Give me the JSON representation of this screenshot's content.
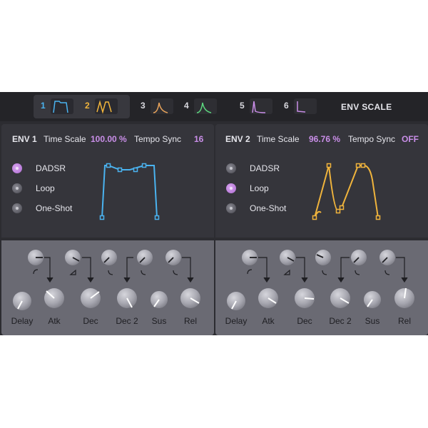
{
  "tabs": [
    {
      "num": "1",
      "color": "#4ab3f0",
      "active": true,
      "shape": "dadsr"
    },
    {
      "num": "2",
      "color": "#f0b43c",
      "active": true,
      "shape": "loop"
    },
    {
      "num": "3",
      "color": "#e8a35a",
      "active": false,
      "shape": "spike"
    },
    {
      "num": "4",
      "color": "#5cd67e",
      "active": false,
      "shape": "spike"
    },
    {
      "num": "5",
      "color": "#c98ee8",
      "active": false,
      "shape": "pulse"
    },
    {
      "num": "6",
      "color": "#c98ee8",
      "active": false,
      "shape": "drop"
    }
  ],
  "env_scale_label": "ENV SCALE",
  "envs": [
    {
      "title": "ENV 1",
      "time_scale_label": "Time Scale",
      "time_scale_value": "100.00 %",
      "tempo_sync_label": "Tempo Sync",
      "tempo_sync_value": "16",
      "color": "#4ab3f0",
      "modes": [
        "DADSR",
        "Loop",
        "One-Shot"
      ],
      "selected_mode": "DADSR",
      "knob_labels": [
        "Delay",
        "Atk",
        "Dec",
        "Dec 2",
        "Sus",
        "Rel"
      ]
    },
    {
      "title": "ENV 2",
      "time_scale_label": "Time Scale",
      "time_scale_value": "96.76 %",
      "tempo_sync_label": "Tempo Sync",
      "tempo_sync_value": "OFF",
      "color": "#f0b43c",
      "modes": [
        "DADSR",
        "Loop",
        "One-Shot"
      ],
      "selected_mode": "Loop",
      "knob_labels": [
        "Delay",
        "Atk",
        "Dec",
        "Dec 2",
        "Sus",
        "Rel"
      ]
    }
  ],
  "colors": {
    "background": "#2c2c31",
    "accent": "#c98ee8",
    "knob_panel": "#6a6a73"
  }
}
